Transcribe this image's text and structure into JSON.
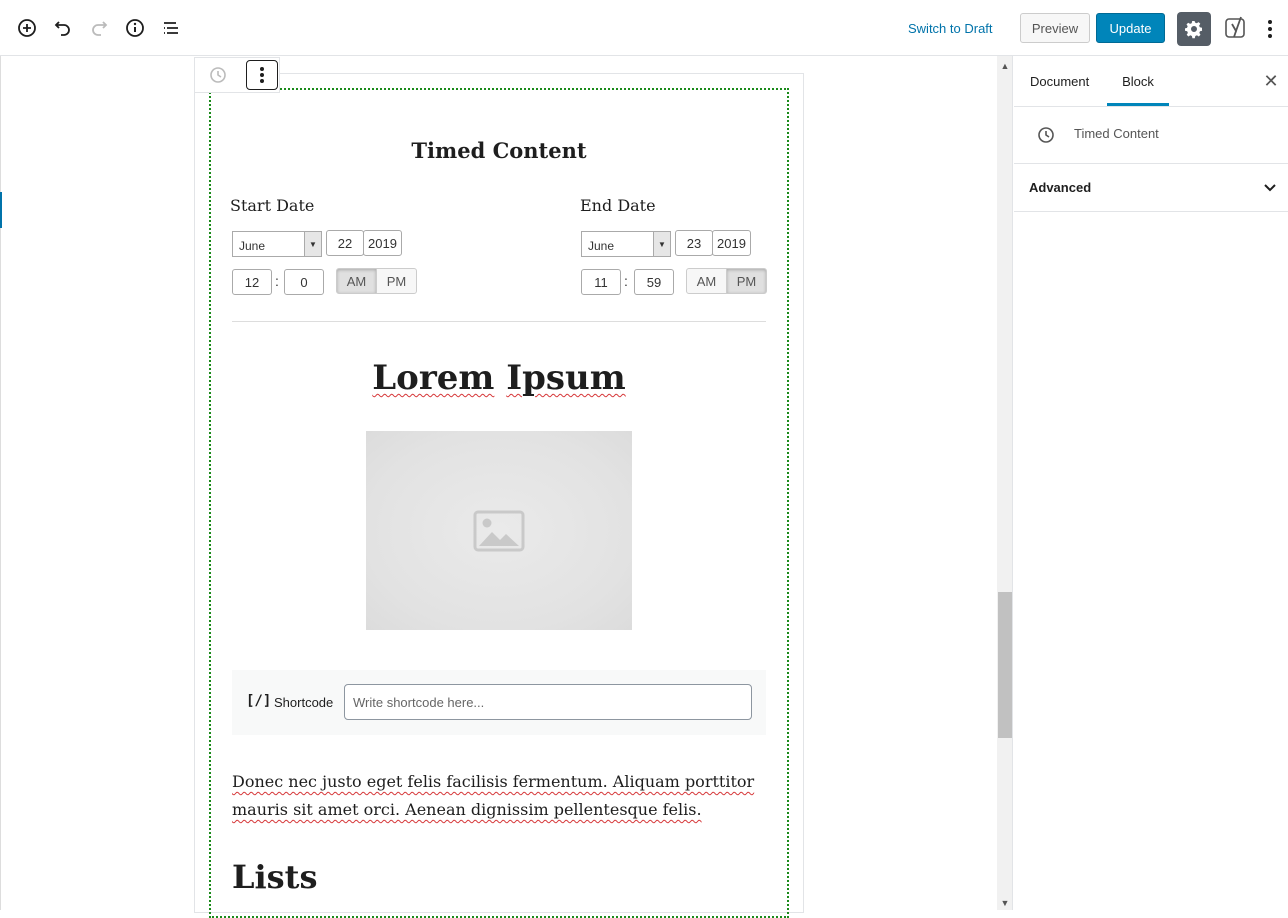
{
  "topbar": {
    "switch_draft": "Switch to Draft",
    "preview": "Preview",
    "update": "Update",
    "icons": [
      "add-block-icon",
      "undo-icon",
      "redo-icon",
      "info-icon",
      "outline-icon",
      "settings-icon",
      "yoast-icon",
      "more-vertical-icon"
    ]
  },
  "sidebar": {
    "tabs": [
      "Document",
      "Block"
    ],
    "active_tab": "Block",
    "block_card_title": "Timed Content",
    "advanced_label": "Advanced"
  },
  "block": {
    "title": "Timed Content",
    "start": {
      "label": "Start Date",
      "month": "June",
      "day": "22",
      "year": "2019",
      "hour": "12",
      "minute": "0",
      "am": "AM",
      "pm": "PM",
      "selected": "AM"
    },
    "end": {
      "label": "End Date",
      "month": "June",
      "day": "23",
      "year": "2019",
      "hour": "11",
      "minute": "59",
      "am": "AM",
      "pm": "PM",
      "selected": "PM"
    },
    "separator": ":"
  },
  "content": {
    "heading_word1": "Lorem",
    "heading_word2": "Ipsum",
    "shortcode_icon": "[/]",
    "shortcode_label": "Shortcode",
    "shortcode_placeholder": "Write shortcode here...",
    "paragraph": "Donec nec justo eget felis facilisis fermentum. Aliquam porttitor mauris sit amet orci. Aenean dignissim pellentesque felis.",
    "lists_heading": "Lists"
  },
  "colors": {
    "accent": "#0085ba",
    "link": "#0073aa",
    "block_border": "#1a8a1a",
    "settings_bg": "#555d66"
  }
}
